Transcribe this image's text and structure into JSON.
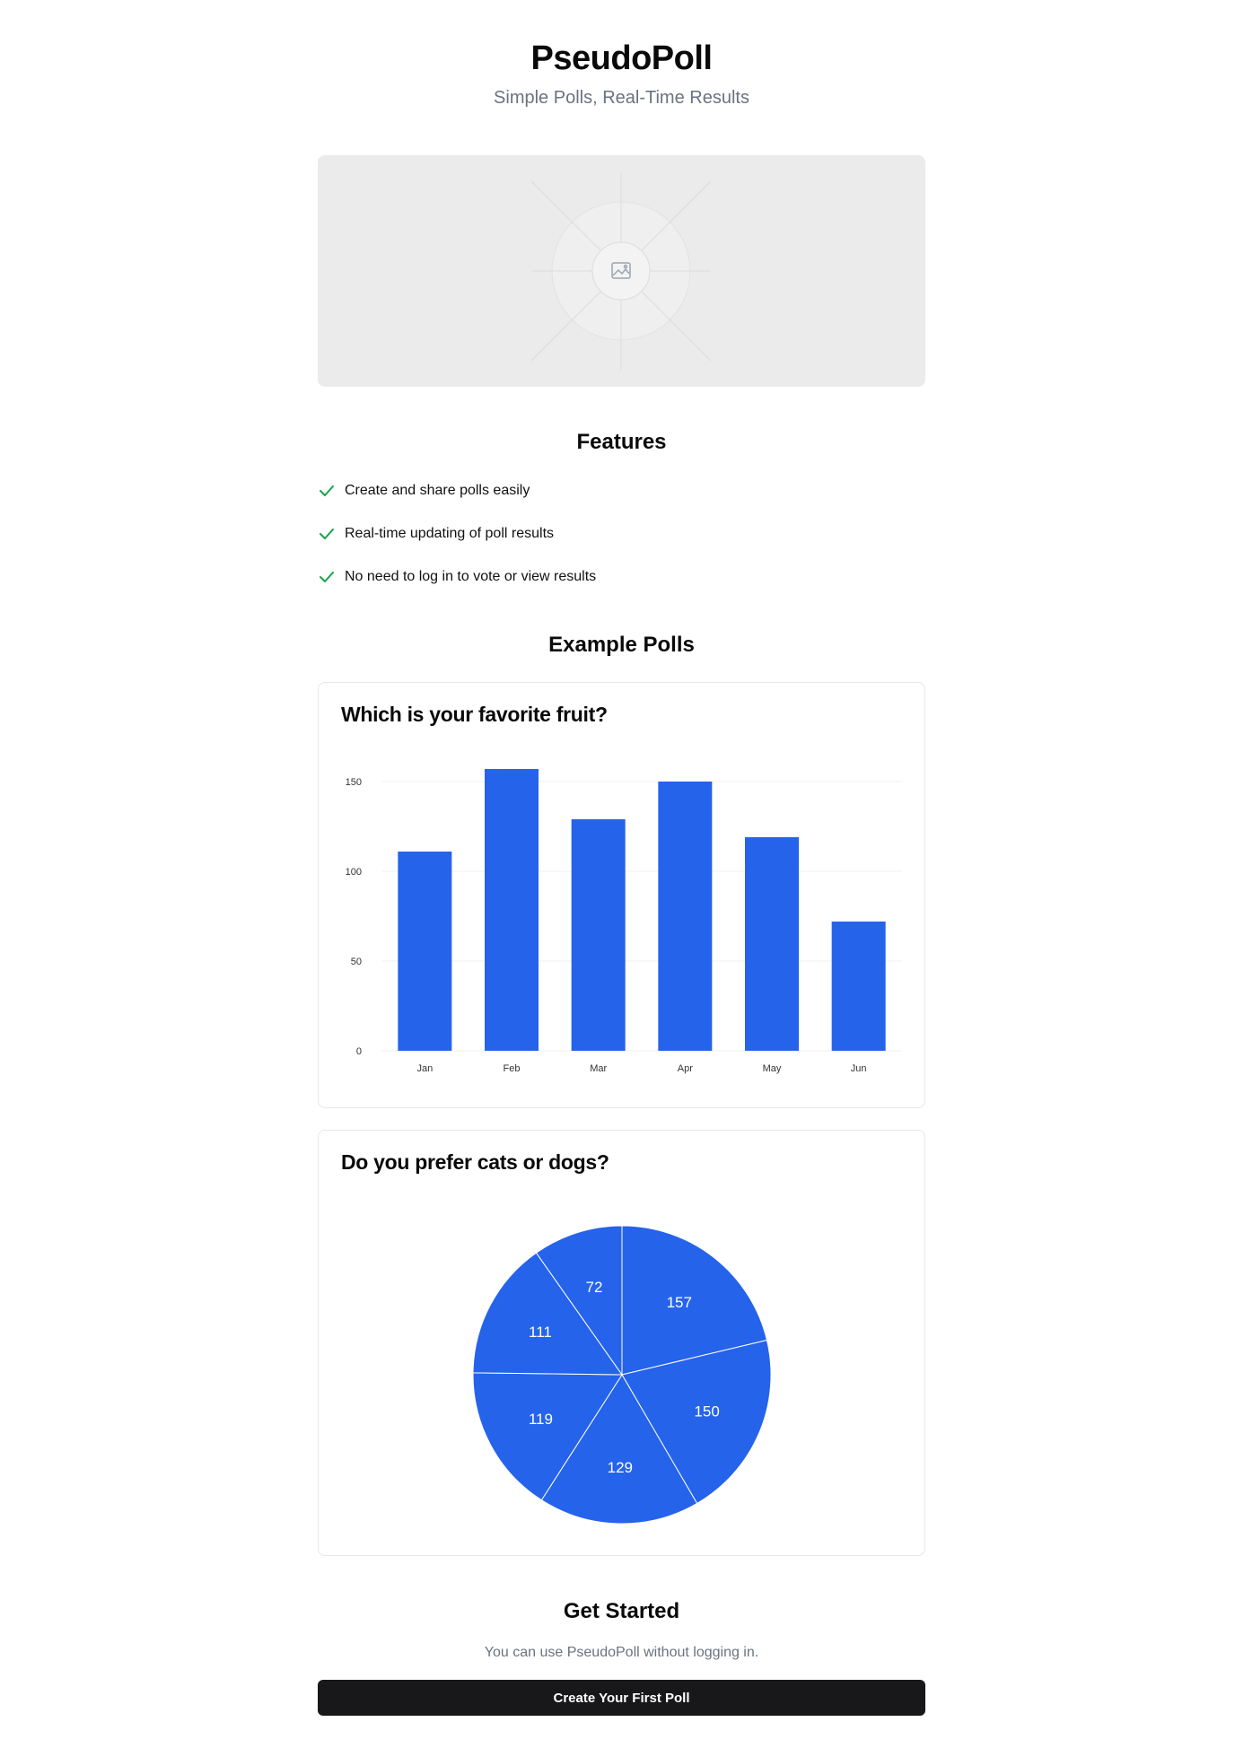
{
  "header": {
    "title": "PseudoPoll",
    "subtitle": "Simple Polls, Real-Time Results"
  },
  "hero": {
    "icon": "image-placeholder-icon"
  },
  "features": {
    "heading": "Features",
    "items": [
      {
        "label": "Create and share polls easily",
        "icon": "check-icon"
      },
      {
        "label": "Real-time updating of poll results",
        "icon": "check-icon"
      },
      {
        "label": "No need to log in to vote or view results",
        "icon": "check-icon"
      }
    ],
    "check_color": "#16a34a"
  },
  "examples": {
    "heading": "Example Polls"
  },
  "polls": [
    {
      "question": "Which is your favorite fruit?"
    },
    {
      "question": "Do you prefer cats or dogs?"
    }
  ],
  "chart_data": [
    {
      "type": "bar",
      "categories": [
        "Jan",
        "Feb",
        "Mar",
        "Apr",
        "May",
        "Jun"
      ],
      "values": [
        111,
        157,
        129,
        150,
        119,
        72
      ],
      "ylim": [
        0,
        150
      ],
      "yticks": [
        "0",
        "50",
        "100",
        "150"
      ],
      "color": "#2563eb",
      "grid": true
    },
    {
      "type": "pie",
      "values": [
        157,
        150,
        129,
        119,
        111,
        72
      ],
      "labels": [
        "157",
        "150",
        "129",
        "119",
        "111",
        "72"
      ],
      "color": "#2563eb"
    }
  ],
  "get_started": {
    "heading": "Get Started",
    "text": "You can use PseudoPoll without logging in.",
    "button_label": "Create Your First Poll"
  }
}
